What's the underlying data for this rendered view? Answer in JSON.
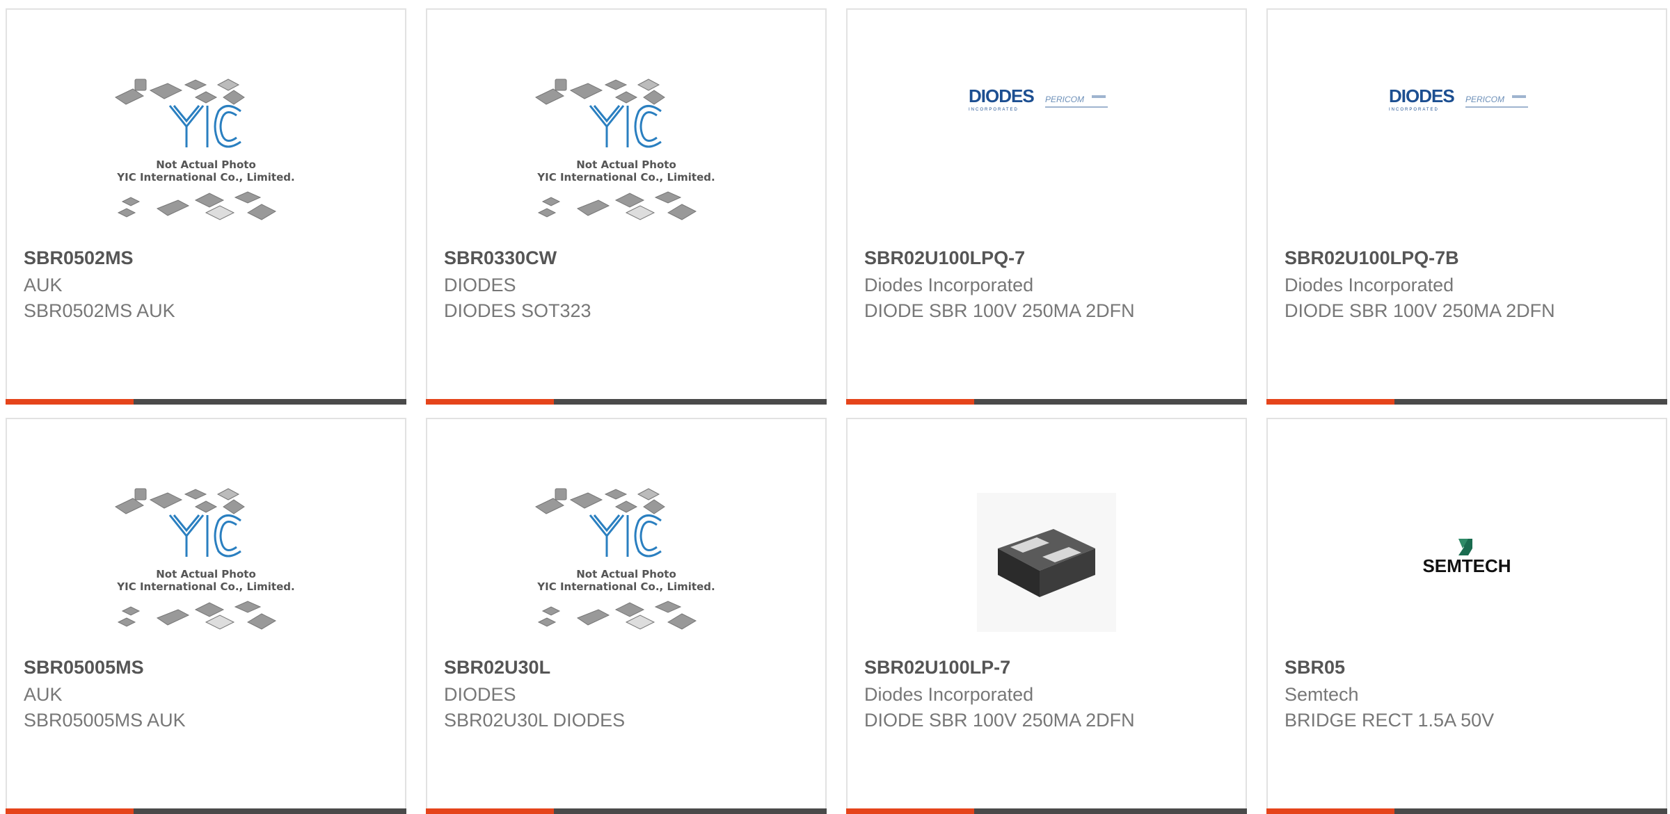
{
  "products": [
    {
      "part_number": "SBR0502MS",
      "manufacturer": "AUK",
      "description": "SBR0502MS AUK",
      "image": "yic-placeholder"
    },
    {
      "part_number": "SBR0330CW",
      "manufacturer": "DIODES",
      "description": "DIODES SOT323",
      "image": "yic-placeholder"
    },
    {
      "part_number": "SBR02U100LPQ-7",
      "manufacturer": "Diodes Incorporated",
      "description": "DIODE SBR 100V 250MA 2DFN",
      "image": "diodes-pericom-logo"
    },
    {
      "part_number": "SBR02U100LPQ-7B",
      "manufacturer": "Diodes Incorporated",
      "description": "DIODE SBR 100V 250MA 2DFN",
      "image": "diodes-pericom-logo"
    },
    {
      "part_number": "SBR05005MS",
      "manufacturer": "AUK",
      "description": "SBR05005MS AUK",
      "image": "yic-placeholder"
    },
    {
      "part_number": "SBR02U30L",
      "manufacturer": "DIODES",
      "description": "SBR02U30L DIODES",
      "image": "yic-placeholder"
    },
    {
      "part_number": "SBR02U100LP-7",
      "manufacturer": "Diodes Incorporated",
      "description": "DIODE SBR 100V 250MA 2DFN",
      "image": "dfn-package-photo"
    },
    {
      "part_number": "SBR05",
      "manufacturer": "Semtech",
      "description": "BRIDGE RECT 1.5A 50V",
      "image": "semtech-logo"
    }
  ],
  "placeholder": {
    "brand": "YIC",
    "line1": "Not Actual Photo",
    "line2": "YIC International Co., Limited."
  },
  "logos": {
    "diodes": "DIODES",
    "diodes_sub": "INCORPORATED",
    "pericom": "PERICOM",
    "semtech": "SEMTECH"
  },
  "colors": {
    "accent": "#e5441b",
    "bar": "#4a4a4a",
    "yic_blue": "#2a7fc0"
  }
}
